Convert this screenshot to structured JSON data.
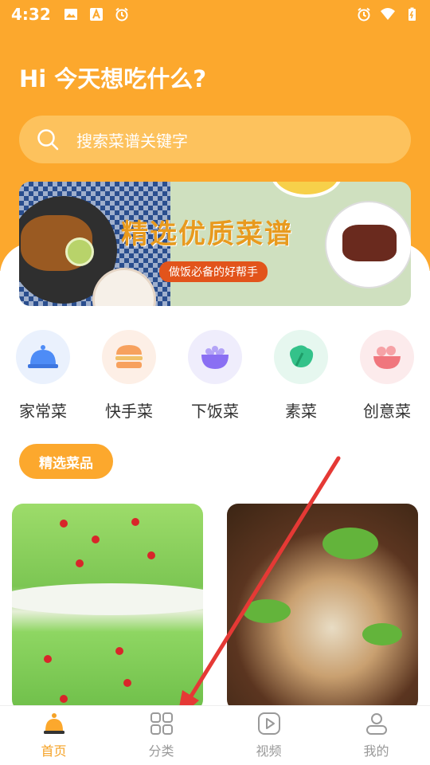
{
  "status_bar": {
    "time": "4:32",
    "left_icons": [
      "image-icon",
      "a-icon",
      "alarm-icon"
    ],
    "right_icons": [
      "alarm-icon",
      "wifi-icon",
      "battery-icon"
    ]
  },
  "header": {
    "greeting": "Hi 今天想吃什么?"
  },
  "search": {
    "placeholder": "搜索菜谱关键字"
  },
  "banner": {
    "title": "精选优质菜谱",
    "subtitle": "做饭必备的好帮手"
  },
  "categories": [
    {
      "label": "家常菜",
      "icon": "cloche-icon",
      "bg": "#EAF1FD",
      "color": "#4E8CF6"
    },
    {
      "label": "快手菜",
      "icon": "burger-icon",
      "bg": "#FDEFE6",
      "color": "#F7A15E"
    },
    {
      "label": "下饭菜",
      "icon": "rice-bowl-icon",
      "bg": "#EFEDFC",
      "color": "#8A6FF3"
    },
    {
      "label": "素菜",
      "icon": "vegetable-icon",
      "bg": "#E6F7EF",
      "color": "#34C28A"
    },
    {
      "label": "创意菜",
      "icon": "fruit-bowl-icon",
      "bg": "#FCEBEC",
      "color": "#F0767D"
    }
  ],
  "section": {
    "label": "精选菜品"
  },
  "bottom_nav": [
    {
      "label": "首页",
      "icon": "home-icon",
      "active": true
    },
    {
      "label": "分类",
      "icon": "category-icon",
      "active": false
    },
    {
      "label": "视频",
      "icon": "video-icon",
      "active": false
    },
    {
      "label": "我的",
      "icon": "profile-icon",
      "active": false
    }
  ],
  "colors": {
    "accent": "#FCA82D",
    "active_nav": "#F5A226",
    "annotation_arrow": "#E53935"
  }
}
